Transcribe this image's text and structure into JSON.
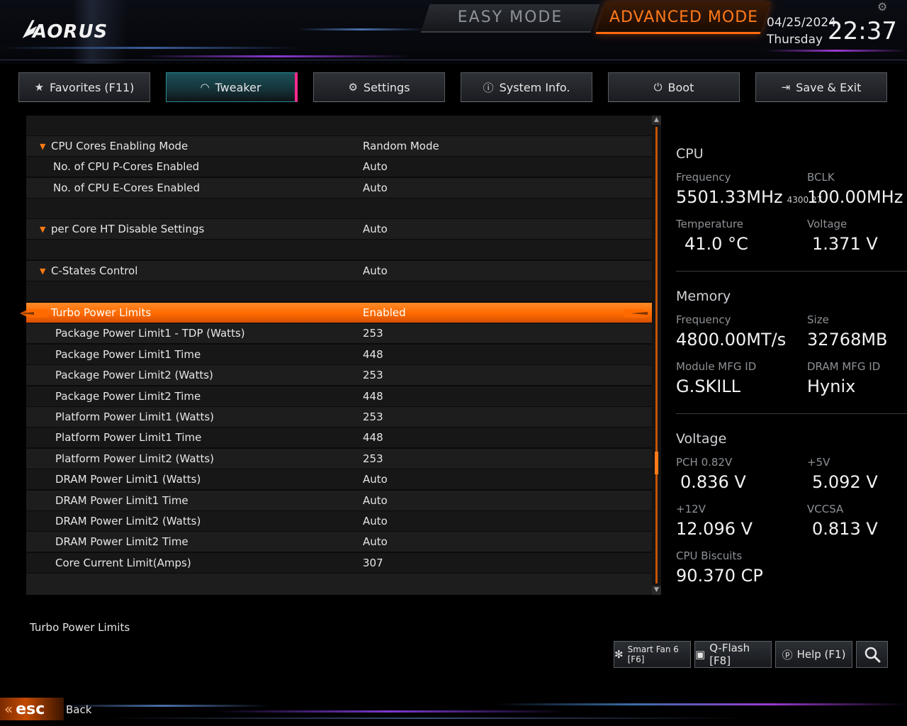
{
  "brand": {
    "logo_text": "AORUS"
  },
  "modes": {
    "easy": "EASY MODE",
    "advanced": "ADVANCED MODE"
  },
  "clock": {
    "date": "04/25/2024",
    "day": "Thursday",
    "time": "22:37"
  },
  "tabs": [
    {
      "label": "Favorites (F11)",
      "icon": "star-folder-icon"
    },
    {
      "label": "Tweaker",
      "icon": "gauge-icon"
    },
    {
      "label": "Settings",
      "icon": "gear-icon"
    },
    {
      "label": "System Info.",
      "icon": "info-icon"
    },
    {
      "label": "Boot",
      "icon": "power-icon"
    },
    {
      "label": "Save & Exit",
      "icon": "exit-icon"
    }
  ],
  "settings": [
    {
      "label": "",
      "value": ""
    },
    {
      "label": "CPU Cores Enabling Mode",
      "value": "Random Mode"
    },
    {
      "label": "No. of CPU P-Cores Enabled",
      "value": "Auto"
    },
    {
      "label": "No. of CPU E-Cores Enabled",
      "value": "Auto"
    },
    {
      "label": "",
      "value": ""
    },
    {
      "label": "per Core HT Disable Settings",
      "value": "Auto"
    },
    {
      "label": "",
      "value": ""
    },
    {
      "label": "C-States Control",
      "value": "Auto"
    },
    {
      "label": "",
      "value": ""
    },
    {
      "label": "Turbo Power Limits",
      "value": "Enabled"
    },
    {
      "label": "Package Power Limit1 - TDP (Watts)",
      "value": "253"
    },
    {
      "label": "Package Power Limit1 Time",
      "value": "448"
    },
    {
      "label": "Package Power Limit2 (Watts)",
      "value": "253"
    },
    {
      "label": "Package Power Limit2 Time",
      "value": "448"
    },
    {
      "label": "Platform Power Limit1 (Watts)",
      "value": "253"
    },
    {
      "label": "Platform Power Limit1 Time",
      "value": "448"
    },
    {
      "label": "Platform Power Limit2 (Watts)",
      "value": "253"
    },
    {
      "label": "DRAM Power Limit1 (Watts)",
      "value": "Auto"
    },
    {
      "label": "DRAM Power Limit1 Time",
      "value": "Auto"
    },
    {
      "label": "DRAM Power Limit2 (Watts)",
      "value": "Auto"
    },
    {
      "label": "DRAM Power Limit2 Time",
      "value": "Auto"
    },
    {
      "label": "Core Current Limit(Amps)",
      "value": "307"
    },
    {
      "label": "",
      "value": ""
    }
  ],
  "info": {
    "cpu": {
      "title": "CPU",
      "frequency_label": "Frequency",
      "frequency": "5501.33MHz",
      "frequency_sub": "4300.27",
      "bclk_label": "BCLK",
      "bclk": "100.00MHz",
      "temperature_label": "Temperature",
      "temperature": "41.0 °C",
      "voltage_label": "Voltage",
      "voltage": "1.371 V"
    },
    "memory": {
      "title": "Memory",
      "frequency_label": "Frequency",
      "frequency": "4800.00MT/s",
      "size_label": "Size",
      "size": "32768MB",
      "module_label": "Module MFG ID",
      "module": "G.SKILL",
      "dram_label": "DRAM MFG ID",
      "dram": "Hynix"
    },
    "voltage": {
      "title": "Voltage",
      "pch_label": "PCH 0.82V",
      "pch": "0.836 V",
      "p5_label": "+5V",
      "p5": "5.092 V",
      "p12_label": "+12V",
      "p12": "12.096 V",
      "vccsa_label": "VCCSA",
      "vccsa": "0.813 V",
      "biscuits_label": "CPU Biscuits",
      "biscuits": "90.370 CP"
    }
  },
  "help_text": "Turbo Power Limits",
  "bottom_buttons": [
    {
      "label": "Smart Fan 6 [F6]",
      "icon": "fan-icon"
    },
    {
      "label": "Q-Flash [F8]",
      "icon": "chip-icon"
    },
    {
      "label": "Help (F1)",
      "icon": "help-icon"
    }
  ],
  "esc": {
    "key": "esc",
    "label": "Back"
  },
  "colors": {
    "accent": "#ff6a00",
    "tab_active": "#1d5058",
    "bg": "#000000"
  }
}
